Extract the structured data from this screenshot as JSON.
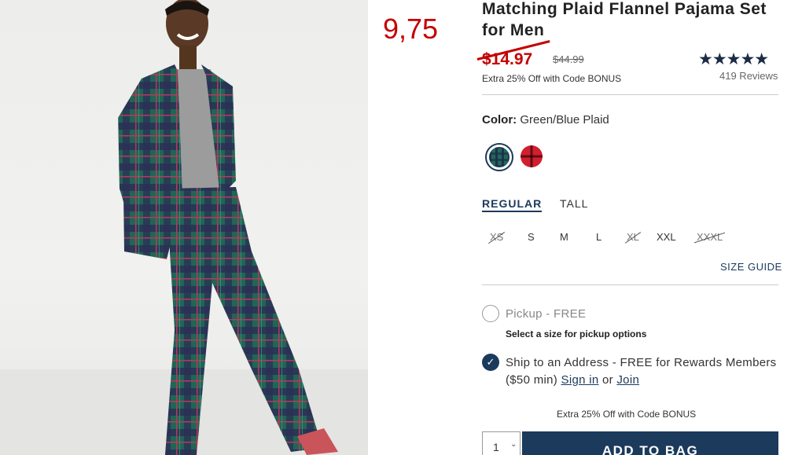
{
  "overlay_price": "9,75",
  "product": {
    "title": "Matching Plaid Flannel Pajama Set for Men",
    "sale_price": "$14.97",
    "original_price": "$44.99",
    "promo": "Extra 25% Off with Code BONUS",
    "rating_stars": "★★★★★",
    "reviews": "419 Reviews"
  },
  "color": {
    "label": "Color:",
    "value": "Green/Blue Plaid",
    "swatches": [
      {
        "name": "Green/Blue Plaid",
        "color": "#1f6a55",
        "selected": true
      },
      {
        "name": "Red Plaid",
        "color": "#d21f2e",
        "selected": false
      }
    ]
  },
  "fit_tabs": [
    {
      "label": "REGULAR",
      "active": true
    },
    {
      "label": "TALL",
      "active": false
    }
  ],
  "sizes": [
    {
      "label": "XS",
      "available": false
    },
    {
      "label": "S",
      "available": true
    },
    {
      "label": "M",
      "available": true
    },
    {
      "label": "L",
      "available": true
    },
    {
      "label": "XL",
      "available": false
    },
    {
      "label": "XXL",
      "available": true
    },
    {
      "label": "XXXL",
      "available": false
    }
  ],
  "size_guide": "SIZE GUIDE",
  "fulfillment": {
    "pickup_label": "Pickup - FREE",
    "pickup_sub": "Select a size for pickup options",
    "ship_text": "Ship to an Address - FREE for Rewards Members ($50 min)",
    "sign_in": "Sign in",
    "or": "or",
    "join": "Join"
  },
  "promo_bottom": "Extra 25% Off with Code BONUS",
  "quantity": "1",
  "add_to_bag": "ADD TO BAG",
  "colors": {
    "accent": "#1b3a5c",
    "sale": "#c40000"
  }
}
